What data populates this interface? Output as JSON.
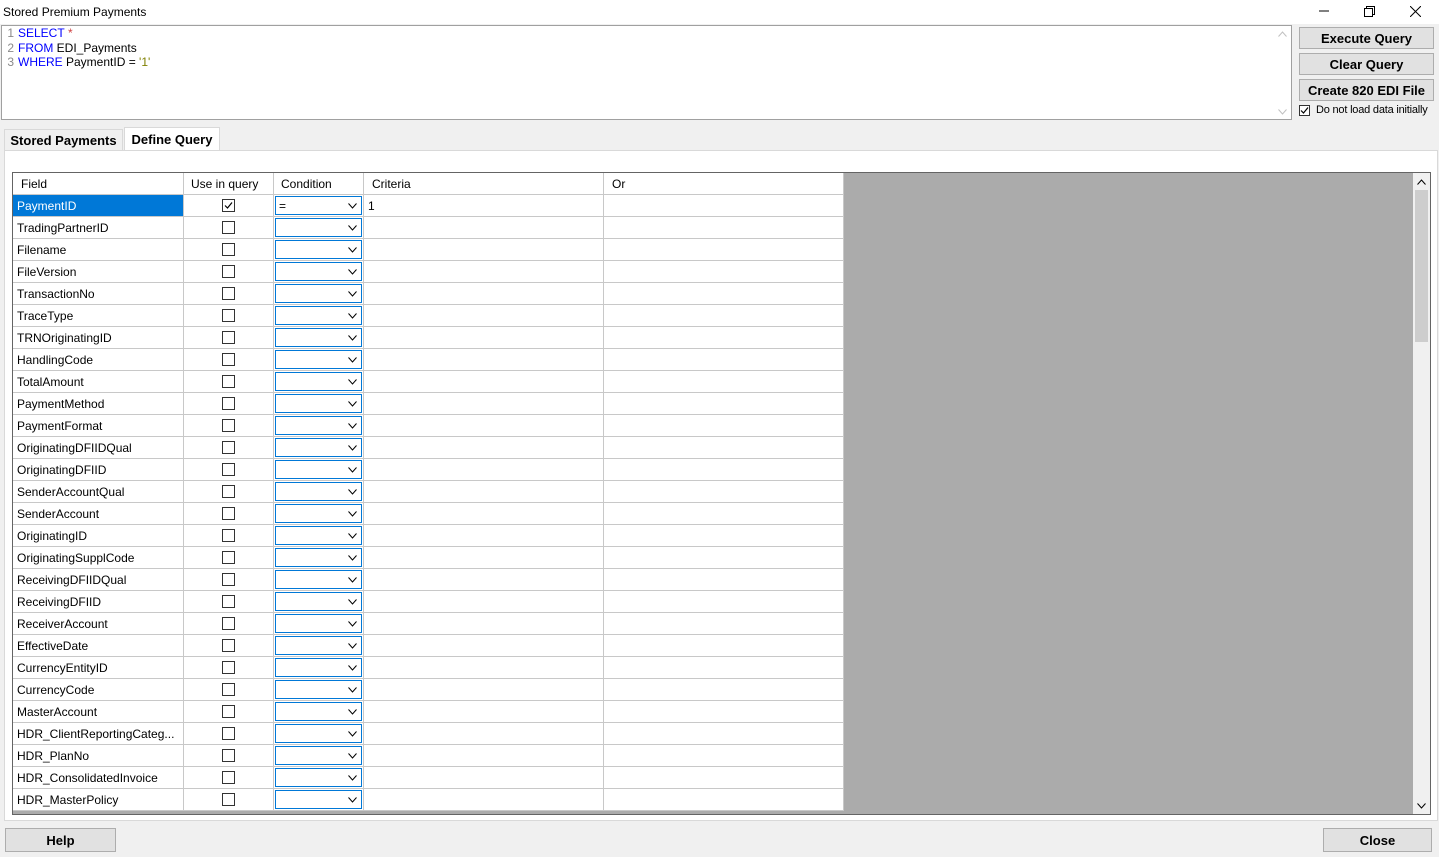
{
  "window": {
    "title": "Stored Premium Payments",
    "minimize_icon": "minimize-icon",
    "restore_icon": "restore-icon",
    "close_icon": "close-x-icon"
  },
  "editor": {
    "lines": [
      {
        "num": "1",
        "kw1": "SELECT",
        "rest": " ",
        "extra": "*"
      },
      {
        "num": "2",
        "kw1": "FROM",
        "rest": " EDI_Payments",
        "extra": ""
      },
      {
        "num": "3",
        "kw1": "WHERE",
        "rest": " PaymentID = ",
        "extra": "'1'"
      }
    ]
  },
  "buttons": {
    "execute": "Execute Query",
    "clear": "Clear Query",
    "create": "Create 820 EDI File"
  },
  "options": {
    "no_load_label": "Do not load data initially",
    "no_load_checked": true
  },
  "tabs": {
    "stored": "Stored Payments",
    "define": "Define Query",
    "active": "define"
  },
  "grid": {
    "headers": {
      "field": "Field",
      "use": "Use in query",
      "condition": "Condition",
      "criteria": "Criteria",
      "or": "Or"
    },
    "rows": [
      {
        "field": "PaymentID",
        "use": true,
        "condition": "=",
        "criteria": "1",
        "or": ""
      },
      {
        "field": "TradingPartnerID",
        "use": false,
        "condition": "",
        "criteria": "",
        "or": ""
      },
      {
        "field": "Filename",
        "use": false,
        "condition": "",
        "criteria": "",
        "or": ""
      },
      {
        "field": "FileVersion",
        "use": false,
        "condition": "",
        "criteria": "",
        "or": ""
      },
      {
        "field": "TransactionNo",
        "use": false,
        "condition": "",
        "criteria": "",
        "or": ""
      },
      {
        "field": "TraceType",
        "use": false,
        "condition": "",
        "criteria": "",
        "or": ""
      },
      {
        "field": "TRNOriginatingID",
        "use": false,
        "condition": "",
        "criteria": "",
        "or": ""
      },
      {
        "field": "HandlingCode",
        "use": false,
        "condition": "",
        "criteria": "",
        "or": ""
      },
      {
        "field": "TotalAmount",
        "use": false,
        "condition": "",
        "criteria": "",
        "or": ""
      },
      {
        "field": "PaymentMethod",
        "use": false,
        "condition": "",
        "criteria": "",
        "or": ""
      },
      {
        "field": "PaymentFormat",
        "use": false,
        "condition": "",
        "criteria": "",
        "or": ""
      },
      {
        "field": "OriginatingDFIIDQual",
        "use": false,
        "condition": "",
        "criteria": "",
        "or": ""
      },
      {
        "field": "OriginatingDFIID",
        "use": false,
        "condition": "",
        "criteria": "",
        "or": ""
      },
      {
        "field": "SenderAccountQual",
        "use": false,
        "condition": "",
        "criteria": "",
        "or": ""
      },
      {
        "field": "SenderAccount",
        "use": false,
        "condition": "",
        "criteria": "",
        "or": ""
      },
      {
        "field": "OriginatingID",
        "use": false,
        "condition": "",
        "criteria": "",
        "or": ""
      },
      {
        "field": "OriginatingSupplCode",
        "use": false,
        "condition": "",
        "criteria": "",
        "or": ""
      },
      {
        "field": "ReceivingDFIIDQual",
        "use": false,
        "condition": "",
        "criteria": "",
        "or": ""
      },
      {
        "field": "ReceivingDFIID",
        "use": false,
        "condition": "",
        "criteria": "",
        "or": ""
      },
      {
        "field": "ReceiverAccount",
        "use": false,
        "condition": "",
        "criteria": "",
        "or": ""
      },
      {
        "field": "EffectiveDate",
        "use": false,
        "condition": "",
        "criteria": "",
        "or": ""
      },
      {
        "field": "CurrencyEntityID",
        "use": false,
        "condition": "",
        "criteria": "",
        "or": ""
      },
      {
        "field": "CurrencyCode",
        "use": false,
        "condition": "",
        "criteria": "",
        "or": ""
      },
      {
        "field": "MasterAccount",
        "use": false,
        "condition": "",
        "criteria": "",
        "or": ""
      },
      {
        "field": "HDR_ClientReportingCateg...",
        "use": false,
        "condition": "",
        "criteria": "",
        "or": ""
      },
      {
        "field": "HDR_PlanNo",
        "use": false,
        "condition": "",
        "criteria": "",
        "or": ""
      },
      {
        "field": "HDR_ConsolidatedInvoice",
        "use": false,
        "condition": "",
        "criteria": "",
        "or": ""
      },
      {
        "field": "HDR_MasterPolicy",
        "use": false,
        "condition": "",
        "criteria": "",
        "or": ""
      }
    ]
  },
  "footer": {
    "help": "Help",
    "close": "Close"
  },
  "colors": {
    "selection": "#0078d7",
    "keyword": "#0000ff",
    "string": "#808000"
  }
}
